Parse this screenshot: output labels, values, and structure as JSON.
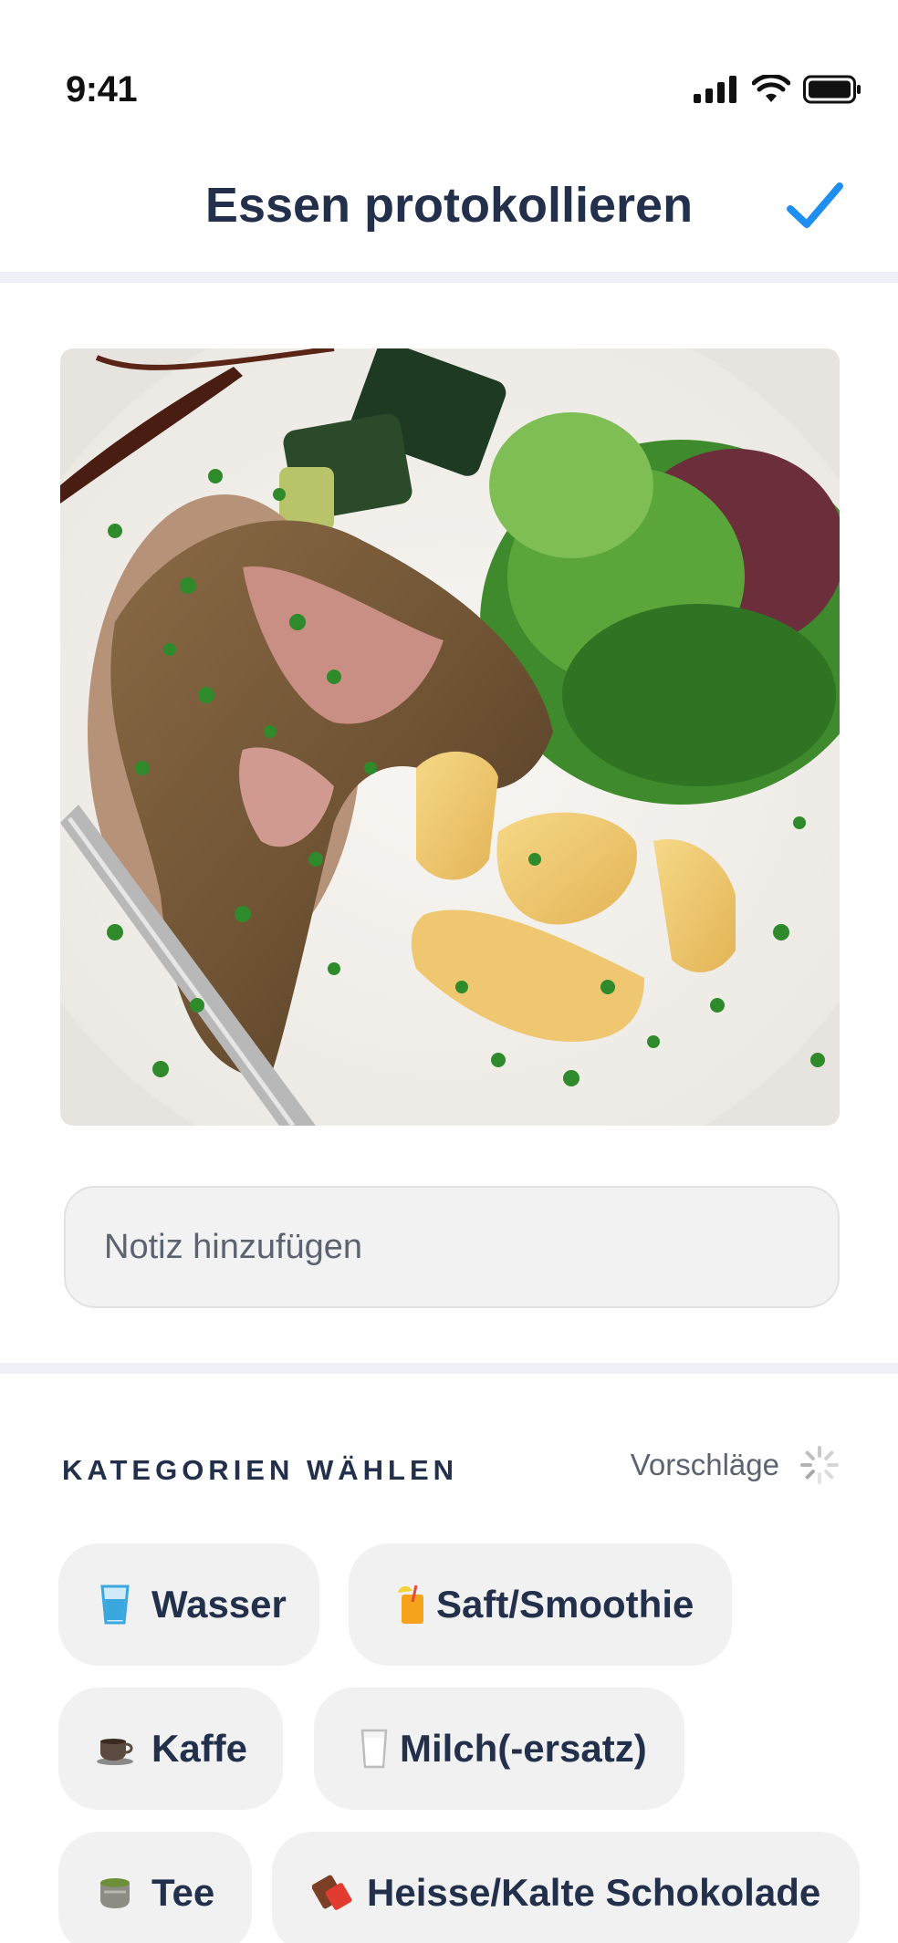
{
  "status_bar": {
    "time": "9:41"
  },
  "header": {
    "title": "Essen protokollieren"
  },
  "note": {
    "placeholder": "Notiz hinzufügen"
  },
  "categories": {
    "title": "KATEGORIEN WÄHLEN",
    "suggestions_label": "Vorschläge",
    "items": [
      {
        "label": "Wasser",
        "icon": "glass-of-water-icon"
      },
      {
        "label": "Saft/Smoothie",
        "icon": "juice-icon"
      },
      {
        "label": "Kaffe",
        "icon": "coffee-cup-icon"
      },
      {
        "label": "Milch(-ersatz)",
        "icon": "milk-glass-icon"
      },
      {
        "label": "Tee",
        "icon": "tea-cup-icon"
      },
      {
        "label": "Heisse/Kalte Schokolade",
        "icon": "chocolate-bar-icon"
      }
    ]
  },
  "colors": {
    "accent": "#1f8ef1",
    "title": "#22304b",
    "chip_bg": "#f1f1f1",
    "divider": "#f0f1f8"
  }
}
